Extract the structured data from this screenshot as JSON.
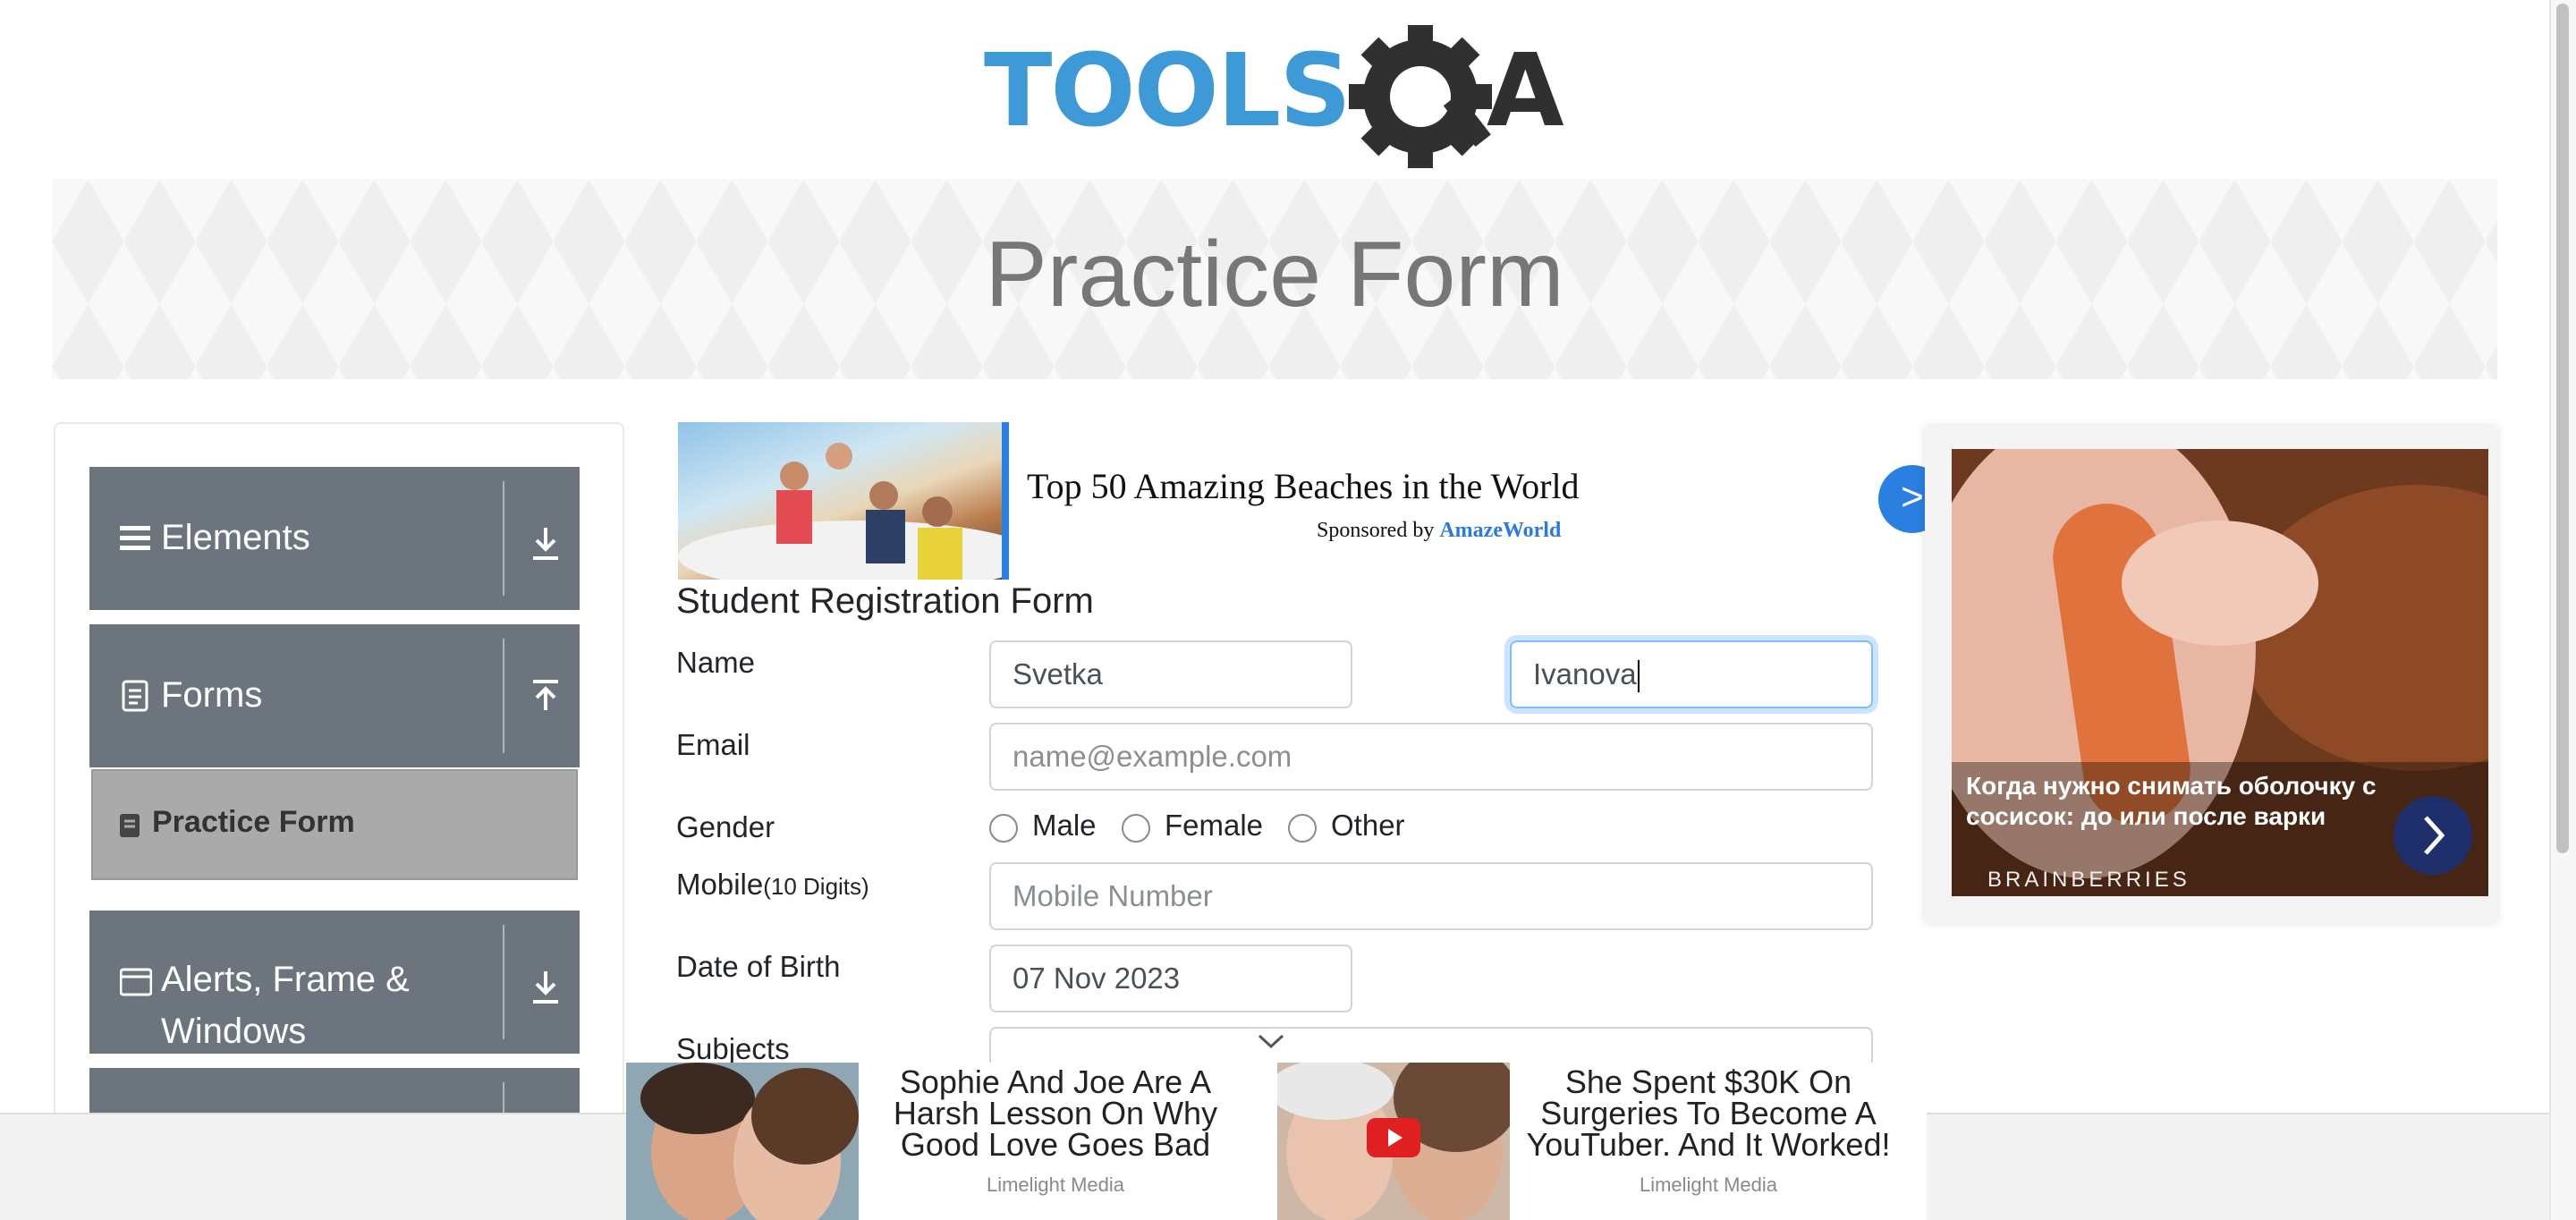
{
  "logo": {
    "text_left": "TOOLS",
    "text_right": "A"
  },
  "banner": {
    "title": "Practice Form"
  },
  "sidebar": {
    "groups": [
      {
        "label": "Elements"
      },
      {
        "label": "Forms"
      },
      {
        "label": "Alerts, Frame &",
        "label2": "Windows"
      }
    ],
    "active_item": {
      "label": "Practice Form"
    }
  },
  "ad_top": {
    "title": "Top 50 Amazing Beaches in the World",
    "sponsor_prefix": "Sponsored by",
    "sponsor_name": "AmazeWorld",
    "next": ">"
  },
  "form": {
    "title": "Student Registration Form",
    "name_label": "Name",
    "first_name_value": "Svetka",
    "last_name_value": "Ivanova",
    "email_label": "Email",
    "email_placeholder": "name@example.com",
    "gender_label": "Gender",
    "gender_options": [
      "Male",
      "Female",
      "Other"
    ],
    "mobile_label": "Mobile",
    "mobile_hint": "(10 Digits)",
    "mobile_placeholder": "Mobile Number",
    "dob_label": "Date of Birth",
    "dob_value": "07 Nov 2023",
    "subjects_label": "Subjects"
  },
  "ad_right": {
    "caption": "Когда нужно снимать оболочку с сосисок: до или после варки",
    "brand": "BRAINBERRIES"
  },
  "ad_bottom": [
    {
      "title": "Sophie And Joe Are A Harsh Lesson On Why Good Love Goes Bad",
      "source": "Limelight Media"
    },
    {
      "title": "She Spent $30K On Surgeries To Become A YouTuber. And It Worked!",
      "source": "Limelight Media"
    }
  ]
}
